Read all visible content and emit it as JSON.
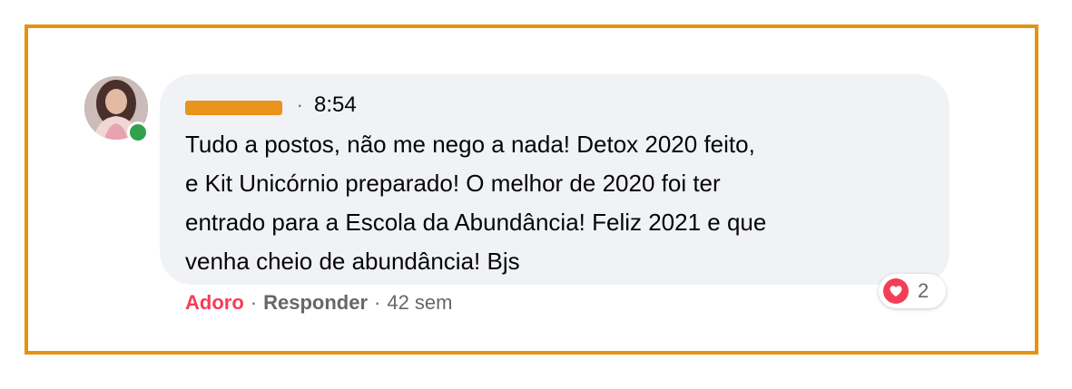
{
  "comment": {
    "author_redacted": "",
    "separator": "·",
    "time": "8:54",
    "lines": [
      "Tudo a postos, não me nego a nada! Detox 2020 feito,",
      "e Kit Unicórnio preparado! O melhor de 2020 foi ter",
      "entrado para a Escola da Abundância! Feliz 2021 e que",
      "venha cheio de abundância! Bjs"
    ],
    "online": true
  },
  "reactions": {
    "icon": "heart-icon",
    "count": "2"
  },
  "actions": {
    "love_label": "Adoro",
    "sep1": "·",
    "reply_label": "Responder",
    "sep2": "·",
    "age": "42 sem"
  },
  "colors": {
    "frame": "#e59310",
    "bubble": "#f0f2f5",
    "love": "#f33e58",
    "online": "#31a24c",
    "redaction": "#e8931a"
  }
}
